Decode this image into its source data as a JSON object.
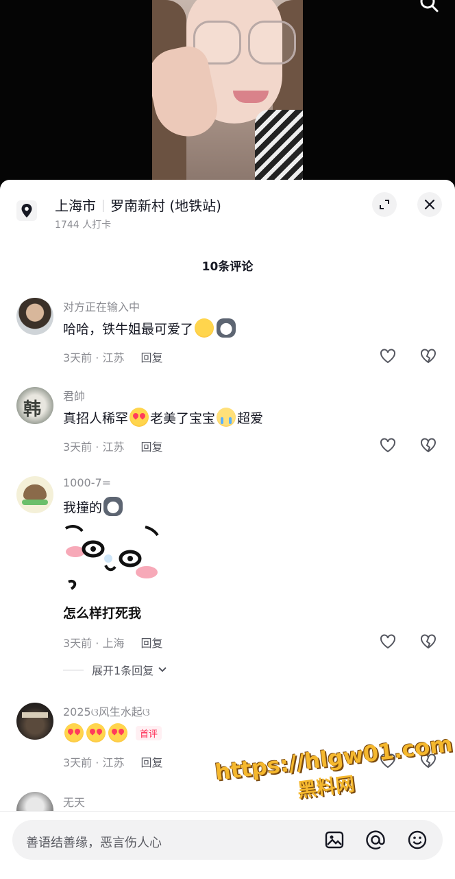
{
  "location": {
    "city": "上海市",
    "place": "罗南新村 (地铁站)",
    "checkins": "1744 人打卡"
  },
  "comments_count": "10条评论",
  "comments": [
    {
      "user": "对方正在输入中",
      "text": "哈哈，铁牛姐最可爱了",
      "time_loc": "3天前 · 江苏",
      "reply": "回复"
    },
    {
      "user": "君帥",
      "text_a": "真招人稀罕",
      "text_b": "老美了宝宝",
      "text_c": "超爱",
      "time_loc": "3天前 · 江苏",
      "reply": "回复"
    },
    {
      "user": "1000-7=",
      "text": "我撞的",
      "sticker_caption": "怎么样打死我",
      "time_loc": "3天前 · 上海",
      "reply": "回复",
      "expand": "展开1条回复"
    },
    {
      "user": "2025ଓ风生水起ଓ",
      "badge": "首评",
      "time_loc": "3天前 · 江苏",
      "reply": "回复"
    },
    {
      "user": "无天"
    }
  ],
  "watermark": {
    "url": "https://hlgw01.com",
    "name": "黑料网"
  },
  "input": {
    "placeholder": "善语结善缘，恶言伤人心"
  },
  "colors": {
    "accent": "#fe2c55",
    "secondary_text": "#8a8b91",
    "watermark": "#f5b82e"
  }
}
